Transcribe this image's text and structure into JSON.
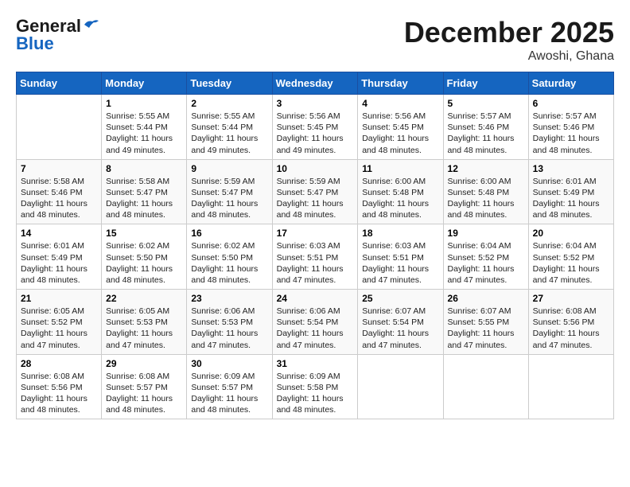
{
  "header": {
    "logo_general": "General",
    "logo_blue": "Blue",
    "month_title": "December 2025",
    "location": "Awoshi, Ghana"
  },
  "weekdays": [
    "Sunday",
    "Monday",
    "Tuesday",
    "Wednesday",
    "Thursday",
    "Friday",
    "Saturday"
  ],
  "weeks": [
    [
      {
        "day": "",
        "sunrise": "",
        "sunset": "",
        "daylight": ""
      },
      {
        "day": "1",
        "sunrise": "Sunrise: 5:55 AM",
        "sunset": "Sunset: 5:44 PM",
        "daylight": "Daylight: 11 hours and 49 minutes."
      },
      {
        "day": "2",
        "sunrise": "Sunrise: 5:55 AM",
        "sunset": "Sunset: 5:44 PM",
        "daylight": "Daylight: 11 hours and 49 minutes."
      },
      {
        "day": "3",
        "sunrise": "Sunrise: 5:56 AM",
        "sunset": "Sunset: 5:45 PM",
        "daylight": "Daylight: 11 hours and 49 minutes."
      },
      {
        "day": "4",
        "sunrise": "Sunrise: 5:56 AM",
        "sunset": "Sunset: 5:45 PM",
        "daylight": "Daylight: 11 hours and 48 minutes."
      },
      {
        "day": "5",
        "sunrise": "Sunrise: 5:57 AM",
        "sunset": "Sunset: 5:46 PM",
        "daylight": "Daylight: 11 hours and 48 minutes."
      },
      {
        "day": "6",
        "sunrise": "Sunrise: 5:57 AM",
        "sunset": "Sunset: 5:46 PM",
        "daylight": "Daylight: 11 hours and 48 minutes."
      }
    ],
    [
      {
        "day": "7",
        "sunrise": "Sunrise: 5:58 AM",
        "sunset": "Sunset: 5:46 PM",
        "daylight": "Daylight: 11 hours and 48 minutes."
      },
      {
        "day": "8",
        "sunrise": "Sunrise: 5:58 AM",
        "sunset": "Sunset: 5:47 PM",
        "daylight": "Daylight: 11 hours and 48 minutes."
      },
      {
        "day": "9",
        "sunrise": "Sunrise: 5:59 AM",
        "sunset": "Sunset: 5:47 PM",
        "daylight": "Daylight: 11 hours and 48 minutes."
      },
      {
        "day": "10",
        "sunrise": "Sunrise: 5:59 AM",
        "sunset": "Sunset: 5:47 PM",
        "daylight": "Daylight: 11 hours and 48 minutes."
      },
      {
        "day": "11",
        "sunrise": "Sunrise: 6:00 AM",
        "sunset": "Sunset: 5:48 PM",
        "daylight": "Daylight: 11 hours and 48 minutes."
      },
      {
        "day": "12",
        "sunrise": "Sunrise: 6:00 AM",
        "sunset": "Sunset: 5:48 PM",
        "daylight": "Daylight: 11 hours and 48 minutes."
      },
      {
        "day": "13",
        "sunrise": "Sunrise: 6:01 AM",
        "sunset": "Sunset: 5:49 PM",
        "daylight": "Daylight: 11 hours and 48 minutes."
      }
    ],
    [
      {
        "day": "14",
        "sunrise": "Sunrise: 6:01 AM",
        "sunset": "Sunset: 5:49 PM",
        "daylight": "Daylight: 11 hours and 48 minutes."
      },
      {
        "day": "15",
        "sunrise": "Sunrise: 6:02 AM",
        "sunset": "Sunset: 5:50 PM",
        "daylight": "Daylight: 11 hours and 48 minutes."
      },
      {
        "day": "16",
        "sunrise": "Sunrise: 6:02 AM",
        "sunset": "Sunset: 5:50 PM",
        "daylight": "Daylight: 11 hours and 48 minutes."
      },
      {
        "day": "17",
        "sunrise": "Sunrise: 6:03 AM",
        "sunset": "Sunset: 5:51 PM",
        "daylight": "Daylight: 11 hours and 47 minutes."
      },
      {
        "day": "18",
        "sunrise": "Sunrise: 6:03 AM",
        "sunset": "Sunset: 5:51 PM",
        "daylight": "Daylight: 11 hours and 47 minutes."
      },
      {
        "day": "19",
        "sunrise": "Sunrise: 6:04 AM",
        "sunset": "Sunset: 5:52 PM",
        "daylight": "Daylight: 11 hours and 47 minutes."
      },
      {
        "day": "20",
        "sunrise": "Sunrise: 6:04 AM",
        "sunset": "Sunset: 5:52 PM",
        "daylight": "Daylight: 11 hours and 47 minutes."
      }
    ],
    [
      {
        "day": "21",
        "sunrise": "Sunrise: 6:05 AM",
        "sunset": "Sunset: 5:52 PM",
        "daylight": "Daylight: 11 hours and 47 minutes."
      },
      {
        "day": "22",
        "sunrise": "Sunrise: 6:05 AM",
        "sunset": "Sunset: 5:53 PM",
        "daylight": "Daylight: 11 hours and 47 minutes."
      },
      {
        "day": "23",
        "sunrise": "Sunrise: 6:06 AM",
        "sunset": "Sunset: 5:53 PM",
        "daylight": "Daylight: 11 hours and 47 minutes."
      },
      {
        "day": "24",
        "sunrise": "Sunrise: 6:06 AM",
        "sunset": "Sunset: 5:54 PM",
        "daylight": "Daylight: 11 hours and 47 minutes."
      },
      {
        "day": "25",
        "sunrise": "Sunrise: 6:07 AM",
        "sunset": "Sunset: 5:54 PM",
        "daylight": "Daylight: 11 hours and 47 minutes."
      },
      {
        "day": "26",
        "sunrise": "Sunrise: 6:07 AM",
        "sunset": "Sunset: 5:55 PM",
        "daylight": "Daylight: 11 hours and 47 minutes."
      },
      {
        "day": "27",
        "sunrise": "Sunrise: 6:08 AM",
        "sunset": "Sunset: 5:56 PM",
        "daylight": "Daylight: 11 hours and 47 minutes."
      }
    ],
    [
      {
        "day": "28",
        "sunrise": "Sunrise: 6:08 AM",
        "sunset": "Sunset: 5:56 PM",
        "daylight": "Daylight: 11 hours and 48 minutes."
      },
      {
        "day": "29",
        "sunrise": "Sunrise: 6:08 AM",
        "sunset": "Sunset: 5:57 PM",
        "daylight": "Daylight: 11 hours and 48 minutes."
      },
      {
        "day": "30",
        "sunrise": "Sunrise: 6:09 AM",
        "sunset": "Sunset: 5:57 PM",
        "daylight": "Daylight: 11 hours and 48 minutes."
      },
      {
        "day": "31",
        "sunrise": "Sunrise: 6:09 AM",
        "sunset": "Sunset: 5:58 PM",
        "daylight": "Daylight: 11 hours and 48 minutes."
      },
      {
        "day": "",
        "sunrise": "",
        "sunset": "",
        "daylight": ""
      },
      {
        "day": "",
        "sunrise": "",
        "sunset": "",
        "daylight": ""
      },
      {
        "day": "",
        "sunrise": "",
        "sunset": "",
        "daylight": ""
      }
    ]
  ]
}
